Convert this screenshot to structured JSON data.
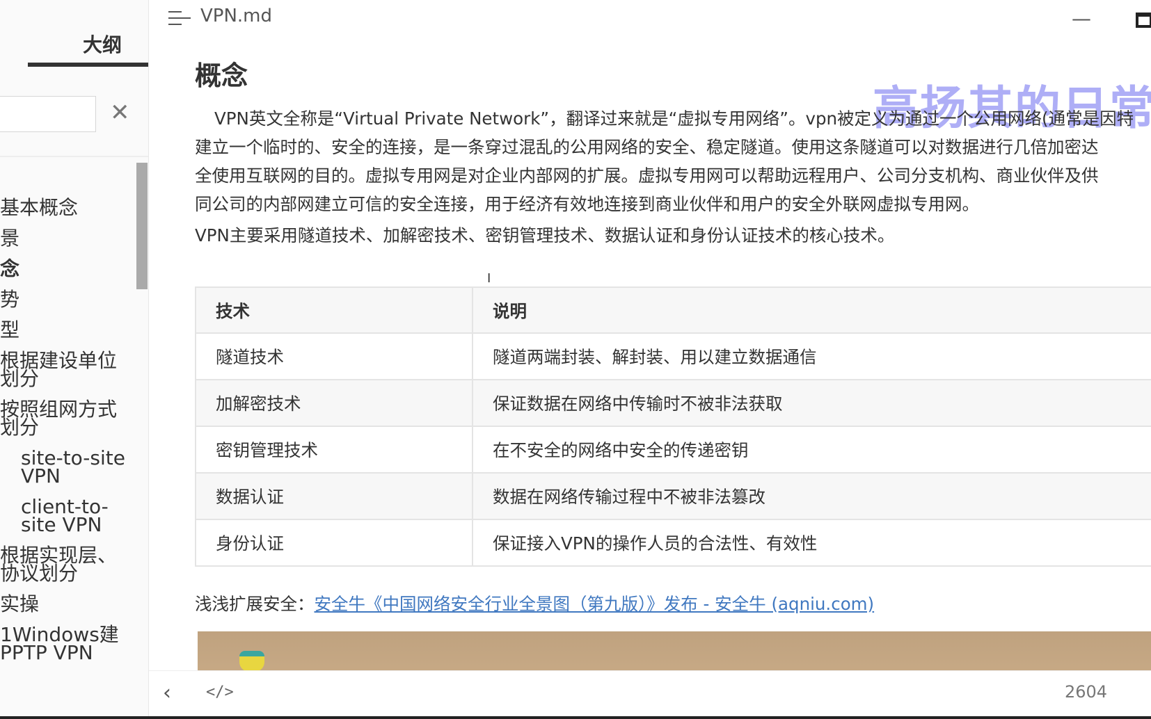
{
  "sidebar": {
    "tab_label": "大纲",
    "search_placeholder": "",
    "close_glyph": "✕",
    "items": [
      {
        "label": "基本概念",
        "active": false,
        "indent": false
      },
      {
        "label": "景",
        "active": false,
        "indent": false
      },
      {
        "label": "念",
        "active": true,
        "indent": false
      },
      {
        "label": "势",
        "active": false,
        "indent": false
      },
      {
        "label": "型",
        "active": false,
        "indent": false
      },
      {
        "label": "根据建设单位划分",
        "active": false,
        "indent": false
      },
      {
        "label": "按照组网方式划分",
        "active": false,
        "indent": false
      },
      {
        "label": "site-to-site VPN",
        "active": false,
        "indent": true
      },
      {
        "label": "client-to-site VPN",
        "active": false,
        "indent": true
      },
      {
        "label": "根据实现层、协议划分",
        "active": false,
        "indent": false
      },
      {
        "label": "实操",
        "active": false,
        "indent": false
      },
      {
        "label": "1Windows建PPTP VPN",
        "active": false,
        "indent": false
      }
    ]
  },
  "header": {
    "title": "VPN.md",
    "minimize_glyph": "—"
  },
  "content": {
    "heading": "概念",
    "watermark": "高扬其的日常练",
    "paragraph_lines": [
      "VPN英文全称是“Virtual Private  Network”，翻译过来就是“虚拟专用网络”。vpn被定义为通过一个公用网络(通常是因特",
      "建立一个临时的、安全的连接，是一条穿过混乱的公用网络的安全、稳定隧道。使用这条隧道可以对数据进行几倍加密达",
      "全使用互联网的目的。虚拟专用网是对企业内部网的扩展。虚拟专用网可以帮助远程用户、公司分支机构、商业伙伴及供",
      "同公司的内部网建立可信的安全连接，用于经济有效地连接到商业伙伴和用户的安全外联网虚拟专用网。"
    ],
    "paragraph2": "VPN主要采用隧道技术、加解密技术、密钥管理技术、数据认证和身份认证技术的核心技术。",
    "table": {
      "headers": [
        "技术",
        "说明"
      ],
      "rows": [
        [
          "隧道技术",
          "隧道两端封装、解封装、用以建立数据通信"
        ],
        [
          "加解密技术",
          "保证数据在网络中传输时不被非法获取"
        ],
        [
          "密钥管理技术",
          "在不安全的网络中安全的传递密钥"
        ],
        [
          "数据认证",
          "数据在网络传输过程中不被非法篡改"
        ],
        [
          "身份认证",
          "保证接入VPN的操作人员的合法性、有效性"
        ]
      ]
    },
    "ext_label": "浅浅扩展安全：",
    "ext_link": "安全牛《中国网络安全行业全景图（第九版）》发布 - 安全牛 (aqniu.com)"
  },
  "footer": {
    "back_glyph": "‹",
    "code_glyph": "</>",
    "word_count": "2604"
  },
  "colors": {
    "link": "#4078c0",
    "watermark": "#7878f0",
    "banner": "#c2a47f"
  }
}
